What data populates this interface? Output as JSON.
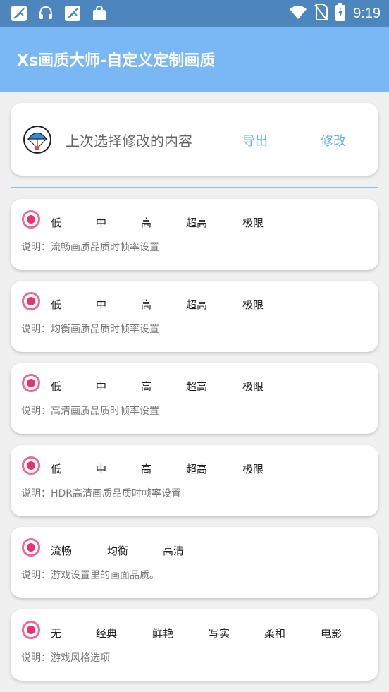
{
  "status_bar": {
    "time": "9:19",
    "icons": [
      "no-signal-icon",
      "headset-icon",
      "no-signal-icon",
      "bag-icon",
      "wifi-icon",
      "no-sim-icon",
      "battery-charging-icon"
    ]
  },
  "app_bar": {
    "title": "Xs画质大师-自定义定制画质"
  },
  "last_selection": {
    "icon": "parachute-icon",
    "label": "上次选择修改的内容",
    "export_label": "导出",
    "modify_label": "修改"
  },
  "settings": [
    {
      "options": [
        "低",
        "中",
        "高",
        "超高",
        "极限"
      ],
      "description": "说明：流畅画质品质时帧率设置"
    },
    {
      "options": [
        "低",
        "中",
        "高",
        "超高",
        "极限"
      ],
      "description": "说明：均衡画质品质时帧率设置"
    },
    {
      "options": [
        "低",
        "中",
        "高",
        "超高",
        "极限"
      ],
      "description": "说明：高清画质品质时帧率设置"
    },
    {
      "options": [
        "低",
        "中",
        "高",
        "超高",
        "极限"
      ],
      "description": "说明：HDR高清画质品质时帧率设置"
    },
    {
      "options": [
        "流畅",
        "均衡",
        "高清"
      ],
      "description": "说明：游戏设置里的画面品质。"
    },
    {
      "options": [
        "无",
        "经典",
        "鲜艳",
        "写实",
        "柔和",
        "电影"
      ],
      "description": "说明：游戏风格选项"
    }
  ],
  "colors": {
    "status_bar": "#4d86bd",
    "app_bar": "#7ab8f5",
    "accent_link": "#6aafea",
    "radio": "#e8336f"
  }
}
